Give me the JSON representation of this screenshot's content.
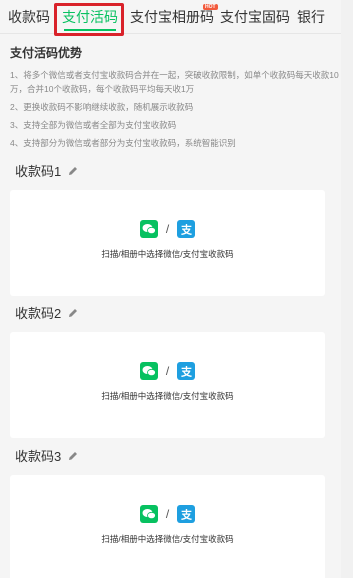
{
  "tabs": [
    {
      "label": "收款码",
      "active": false
    },
    {
      "label": "支付活码",
      "active": true
    },
    {
      "label": "支付宝相册码",
      "active": false,
      "badge": "HOT"
    },
    {
      "label": "支付宝固码",
      "active": false
    },
    {
      "label": "银行",
      "active": false
    }
  ],
  "intro": {
    "title": "支付活码优势",
    "items": [
      "1、将多个微信或者支付宝收款码合并在一起，突破收款限制，如单个收款码每天收款10万，合并10个收款码，每个收款码平均每天收1万",
      "2、更换收款码不影响继续收款，随机展示收款码",
      "3、支持全部为微信或者全部为支付宝收款码",
      "4、支持部分为微信或者部分为支付宝收款码，系统智能识别"
    ]
  },
  "codes": [
    {
      "title": "收款码1",
      "hint": "扫描/相册中选择微信/支付宝收款码",
      "separator": "/"
    },
    {
      "title": "收款码2",
      "hint": "扫描/相册中选择微信/支付宝收款码",
      "separator": "/"
    },
    {
      "title": "收款码3",
      "hint": "扫描/相册中选择微信/支付宝收款码",
      "separator": "/"
    }
  ],
  "colors": {
    "accent": "#07c160",
    "alipay": "#1e9fe0",
    "highlight": "#d9222a"
  },
  "icons": {
    "wechat": "wechat-icon",
    "alipay": "alipay-icon",
    "edit": "pencil-icon"
  }
}
